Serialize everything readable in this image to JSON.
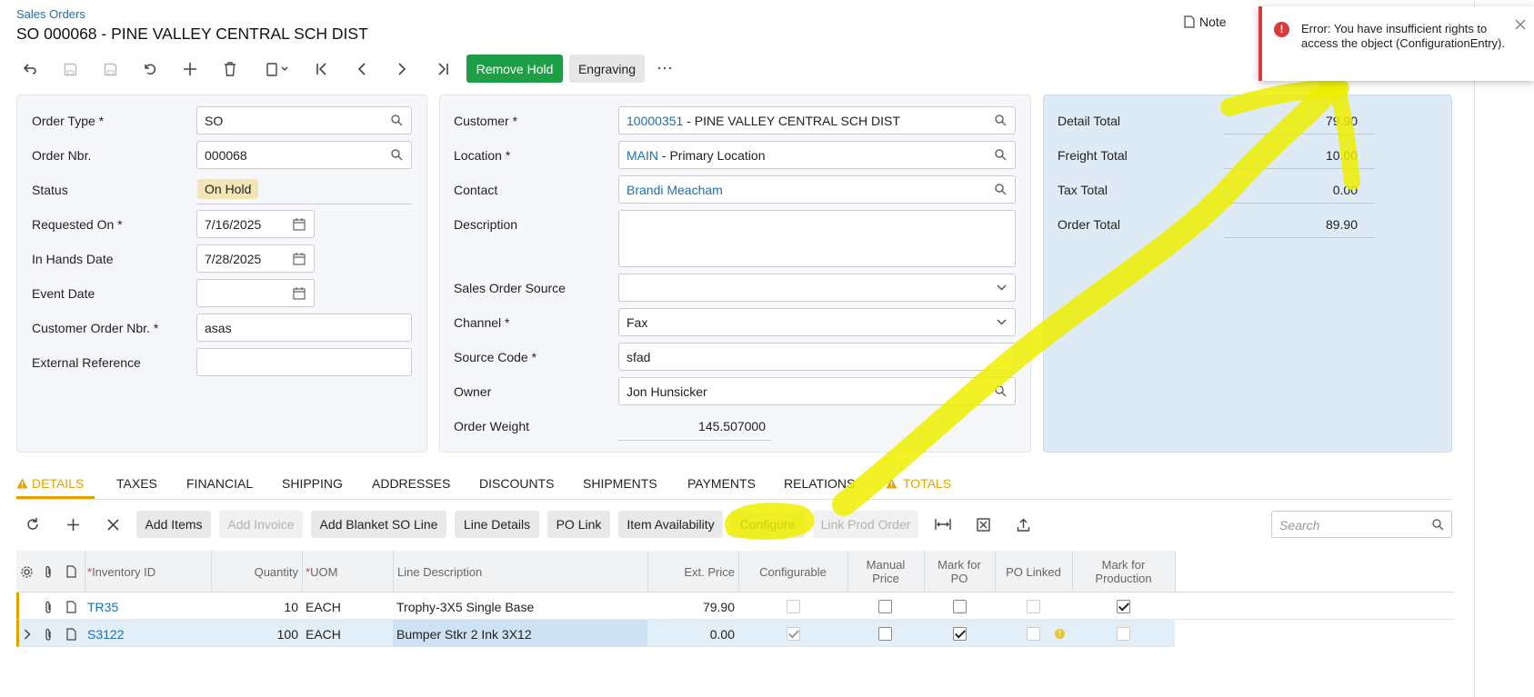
{
  "header": {
    "breadcrumb": "Sales Orders",
    "title": "SO 000068 - PINE VALLEY CENTRAL SCH DIST",
    "note_label": "Note"
  },
  "toolbar": {
    "remove_hold": "Remove Hold",
    "engraving": "Engraving",
    "more": "⋯"
  },
  "left": {
    "order_type_label": "Order Type",
    "order_type": "SO",
    "order_nbr_label": "Order Nbr.",
    "order_nbr": "000068",
    "status_label": "Status",
    "status": "On Hold",
    "requested_on_label": "Requested On",
    "requested_on": "7/16/2025",
    "in_hands_label": "In Hands Date",
    "in_hands": "7/28/2025",
    "event_date_label": "Event Date",
    "event_date": "",
    "cust_order_label": "Customer Order Nbr.",
    "cust_order": "asas",
    "ext_ref_label": "External Reference",
    "ext_ref": ""
  },
  "mid": {
    "customer_label": "Customer",
    "customer_id": "10000351",
    "customer_name": " - PINE VALLEY CENTRAL SCH DIST",
    "location_label": "Location",
    "location_id": "MAIN",
    "location_name": " - Primary Location",
    "contact_label": "Contact",
    "contact": "Brandi Meacham",
    "description_label": "Description",
    "description": "",
    "source_label": "Sales Order Source",
    "source": "",
    "channel_label": "Channel",
    "channel": "Fax",
    "source_code_label": "Source Code",
    "source_code": "sfad",
    "owner_label": "Owner",
    "owner": "Jon Hunsicker",
    "weight_label": "Order Weight",
    "weight": "145.507000"
  },
  "totals": {
    "detail_label": "Detail Total",
    "detail": "79.90",
    "freight_label": "Freight Total",
    "freight": "10.00",
    "tax_label": "Tax Total",
    "tax": "0.00",
    "order_label": "Order Total",
    "order": "89.90"
  },
  "tabs": [
    "DETAILS",
    "TAXES",
    "FINANCIAL",
    "SHIPPING",
    "ADDRESSES",
    "DISCOUNTS",
    "SHIPMENTS",
    "PAYMENTS",
    "RELATIONS",
    "TOTALS"
  ],
  "grid_toolbar": {
    "add_items": "Add Items",
    "add_invoice": "Add Invoice",
    "add_blanket": "Add Blanket SO Line",
    "line_details": "Line Details",
    "po_link": "PO Link",
    "item_availability": "Item Availability",
    "configure": "Configure",
    "link_prod": "Link Prod Order",
    "search_placeholder": "Search"
  },
  "grid": {
    "headers": {
      "inventory": "Inventory ID",
      "quantity": "Quantity",
      "uom": "UOM",
      "line_desc": "Line Description",
      "ext_price": "Ext. Price",
      "configurable": "Configurable",
      "manual_price_1": "Manual",
      "manual_price_2": "Price",
      "mark_po_1": "Mark for",
      "mark_po_2": "PO",
      "po_linked": "PO Linked",
      "mark_prod_1": "Mark for",
      "mark_prod_2": "Production"
    },
    "rows": [
      {
        "inventory": "TR35",
        "quantity": "10",
        "uom": "EACH",
        "desc": "Trophy-3X5 Single Base",
        "ext_price": "79.90",
        "configurable": false,
        "manual_price": false,
        "mark_po": false,
        "po_linked": false,
        "mark_prod": true
      },
      {
        "inventory": "S3122",
        "quantity": "100",
        "uom": "EACH",
        "desc": "Bumper Stkr 2 Ink 3X12",
        "ext_price": "0.00",
        "configurable": true,
        "manual_price": false,
        "mark_po": true,
        "po_linked": false,
        "mark_prod": false
      }
    ]
  },
  "error": {
    "message": "Error: You have insufficient rights to access the object (ConfigurationEntry)."
  },
  "colors": {
    "accent": "#1a6fb5",
    "green": "#1e9e47",
    "warning": "#e2a200",
    "error": "#d93a3a",
    "highlighter": "#eeee00"
  }
}
